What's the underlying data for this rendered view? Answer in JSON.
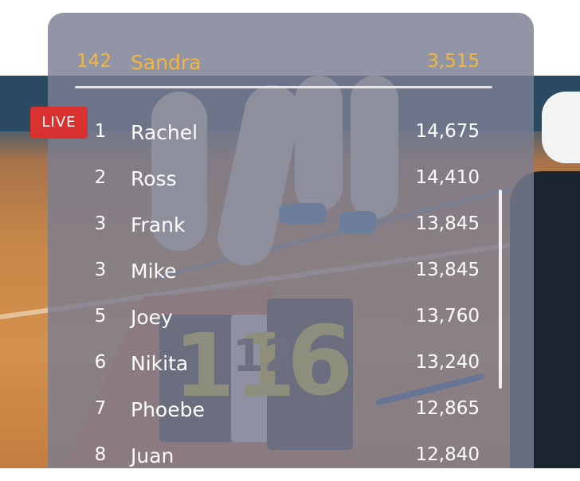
{
  "live_badge": "LIVE",
  "current_user": {
    "rank": "142",
    "name": "Sandra",
    "score": "3,515"
  },
  "leaderboard": [
    {
      "rank": "1",
      "name": "Rachel",
      "score": "14,675"
    },
    {
      "rank": "2",
      "name": "Ross",
      "score": "14,410"
    },
    {
      "rank": "3",
      "name": "Frank",
      "score": "13,845"
    },
    {
      "rank": "3",
      "name": "Mike",
      "score": "13,845"
    },
    {
      "rank": "5",
      "name": "Joey",
      "score": "13,760"
    },
    {
      "rank": "6",
      "name": "Nikita",
      "score": "13,240"
    },
    {
      "rank": "7",
      "name": "Phoebe",
      "score": "12,865"
    },
    {
      "rank": "8",
      "name": "Juan",
      "score": "12,840"
    }
  ],
  "scoreboard_digits": [
    "11",
    "12",
    "6"
  ],
  "colors": {
    "highlight": "#f4b53b",
    "live": "#d8312f",
    "panel": "#7a7e91"
  }
}
